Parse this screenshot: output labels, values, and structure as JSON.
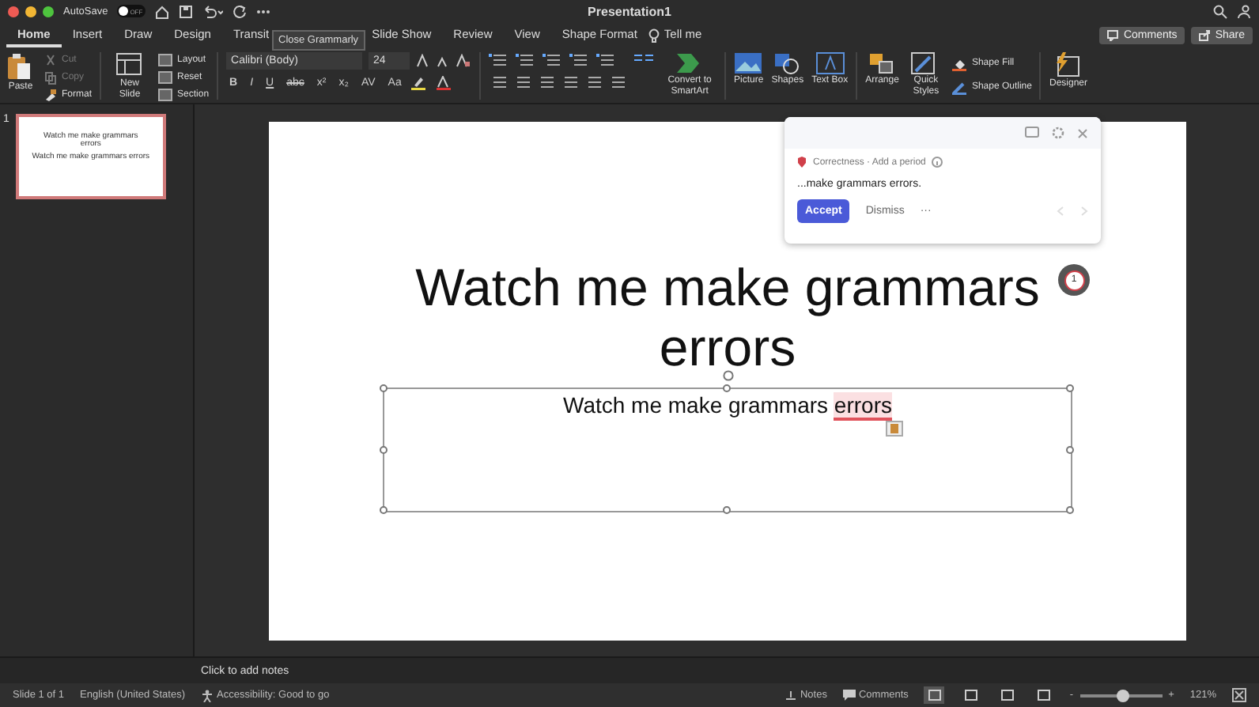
{
  "window": {
    "title": "Presentation1",
    "autosave_label": "AutoSave",
    "autosave_on": false,
    "autosave_state": "OFF"
  },
  "tabs": [
    {
      "label": "Home",
      "selected": true
    },
    {
      "label": "Insert",
      "selected": false
    },
    {
      "label": "Draw",
      "selected": false
    },
    {
      "label": "Design",
      "selected": false
    },
    {
      "label": "Transit",
      "selected": false
    },
    {
      "label": "Slide Show",
      "selected": false
    },
    {
      "label": "Review",
      "selected": false
    },
    {
      "label": "View",
      "selected": false
    },
    {
      "label": "Shape Format",
      "selected": false
    }
  ],
  "tell_me": "Tell me",
  "tooltip": "Close Grammarly",
  "header_buttons": [
    "Comments",
    "Share"
  ],
  "ribbon": {
    "paste": "Paste",
    "clipboard_items": [
      {
        "label": "Cut",
        "disabled": true
      },
      {
        "label": "Copy",
        "disabled": true
      },
      {
        "label": "Format",
        "disabled": false
      }
    ],
    "new_slide": "New Slide",
    "slide_items": [
      "Layout",
      "Reset",
      "Section"
    ],
    "font_name": "Calibri (Body)",
    "font_size": "24",
    "format_buttons": [
      "B",
      "I",
      "U",
      "abc",
      "x²",
      "x₂",
      "AV",
      "Aa"
    ],
    "convert": "Convert to SmartArt",
    "insert_buttons": [
      "Picture",
      "Shapes",
      "Text Box"
    ],
    "arrange": "Arrange",
    "quick_styles": "Quick Styles",
    "shape_items": [
      "Shape Fill",
      "Shape Outline"
    ],
    "designer": "Designer"
  },
  "thumbnails": [
    {
      "number": "1",
      "selected": true,
      "title": "Watch me make grammars errors",
      "subtitle": "Watch me make grammars errors"
    }
  ],
  "slide": {
    "title": "Watch me make grammars errors",
    "body": [
      {
        "text": "Watch me make grammars ",
        "flagged": false
      },
      {
        "text": "errors",
        "flagged": true
      }
    ]
  },
  "grammarly_card": {
    "category": "Correctness · Add a period",
    "suggestion": "...make grammars errors.",
    "accept": "Accept",
    "dismiss": "Dismiss",
    "more": "···"
  },
  "grammarly_badge": "1",
  "notes_placeholder": "Click to add notes",
  "status_bar": {
    "slide": "Slide 1 of 1",
    "language": "English (United States)",
    "accessibility": "Accessibility: Good to go",
    "notes": "Notes",
    "comments": "Comments",
    "views": [
      {
        "selected": true
      },
      {
        "selected": false
      },
      {
        "selected": false
      },
      {
        "selected": false
      }
    ],
    "minus": "-",
    "plus": "+",
    "zoom": {
      "level": 0.52
    },
    "zoom_text": "121%"
  }
}
